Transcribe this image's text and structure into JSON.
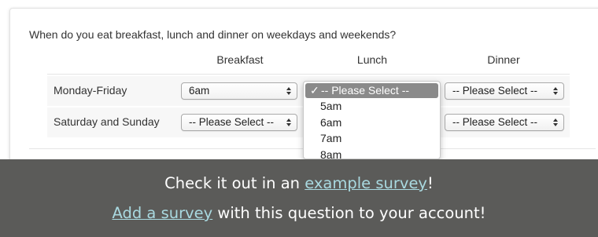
{
  "question": "When do you eat breakfast, lunch and dinner on weekdays and weekends?",
  "columns": [
    "Breakfast",
    "Lunch",
    "Dinner"
  ],
  "rows": [
    {
      "label": "Monday-Friday",
      "breakfast": "6am",
      "lunch": "-- Please Select --",
      "dinner": "-- Please Select --"
    },
    {
      "label": "Saturday and Sunday",
      "breakfast": "-- Please Select --",
      "lunch": "",
      "dinner": "-- Please Select --"
    }
  ],
  "dropdown": {
    "selected": "-- Please Select --",
    "check": "✓",
    "options": [
      "5am",
      "6am",
      "7am",
      "8am"
    ]
  },
  "overlay": {
    "line1_prefix": "Check it out in an ",
    "line1_link": "example survey",
    "line1_suffix": "!",
    "line2_link": "Add a survey",
    "line2_suffix": " with this question to your account!",
    "background": "#5b5b59",
    "link_color": "#a9d9e0"
  }
}
